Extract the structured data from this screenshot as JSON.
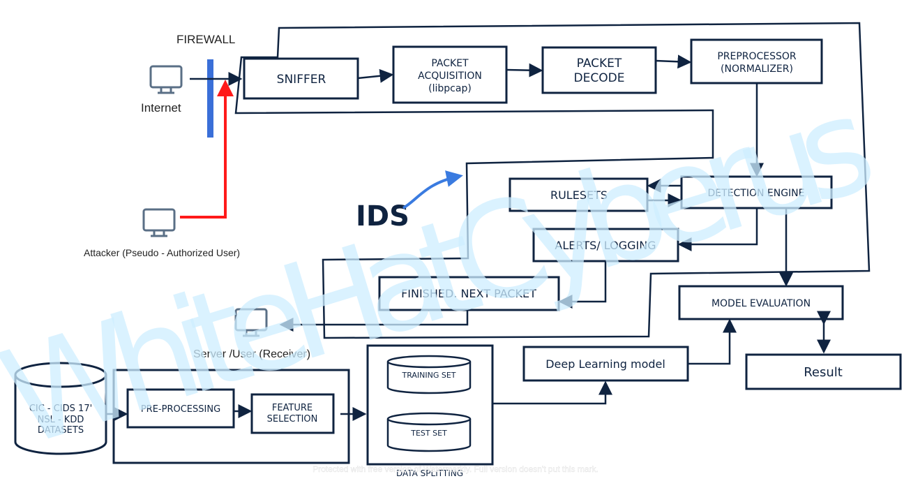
{
  "labels": {
    "firewall": "FIREWALL",
    "internet": "Internet",
    "attacker": "Attacker (Pseudo - Authorized User)",
    "server": "Server /User (Receiver)",
    "ids": "IDS",
    "sniffer": "SNIFFER",
    "packet_acquisition": [
      "PACKET",
      "ACQUISITION",
      "(libpcap)"
    ],
    "packet_decode": [
      "PACKET",
      "DECODE"
    ],
    "preprocessor": [
      "PREPROCESSOR",
      "(NORMALIZER)"
    ],
    "rulesets": "RULESETS",
    "detection_engine": "DETECTION ENGINE",
    "alerts_logging": "ALERTS/ LOGGING",
    "finished": "FINISHED. NEXT PACKET",
    "model_evaluation": "MODEL EVALUATION",
    "result": "Result",
    "deep_learning": "Deep Learning model",
    "datasets": [
      "CIC - CIDS 17'",
      "NSL - KDD",
      "DATASETS"
    ],
    "pre_processing": "PRE-PROCESSING",
    "feature_selection": [
      "FEATURE",
      "SELECTION"
    ],
    "training_set": "TRAINING SET",
    "test_set": "TEST SET",
    "data_splitting": "DATA SPLITTING"
  },
  "watermark": "WhiteHatCyberus",
  "footer_watermark": "Protected with free version of Watermarkly. Full version doesn't put this mark.",
  "colors": {
    "navy": "#0f2340",
    "firewall": "#3a6fd8",
    "attack": "#ff1a1a",
    "watermark": "#cdeeff"
  }
}
